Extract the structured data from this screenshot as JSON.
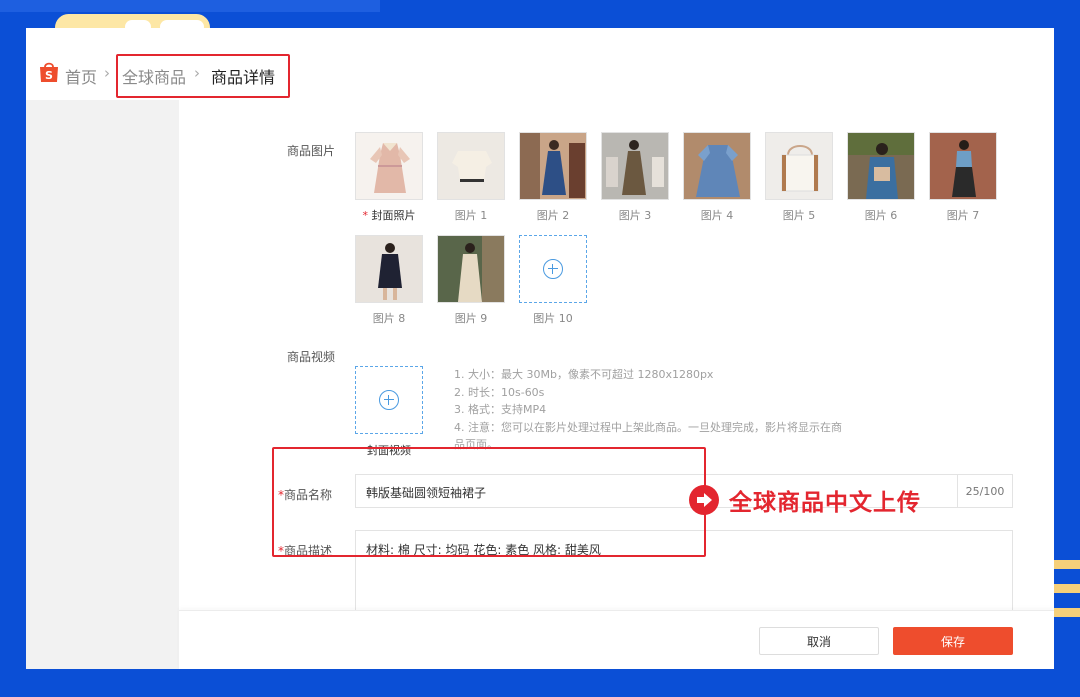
{
  "breadcrumb": {
    "home": "首页",
    "global_products": "全球商品",
    "current": "商品详情"
  },
  "form": {
    "images_label": "商品图片",
    "images": [
      {
        "caption": "封面照片",
        "required_mark": "*"
      },
      {
        "caption": "图片 1"
      },
      {
        "caption": "图片 2"
      },
      {
        "caption": "图片 3"
      },
      {
        "caption": "图片 4"
      },
      {
        "caption": "图片 5"
      },
      {
        "caption": "图片 6"
      },
      {
        "caption": "图片 7"
      },
      {
        "caption": "图片 8"
      },
      {
        "caption": "图片 9"
      }
    ],
    "add_image_caption": "图片 10",
    "video_label": "商品视频",
    "video_caption": "封面视频",
    "video_notes": [
      "1. 大小：最大 30Mb，像素不可超过 1280x1280px",
      "2. 时长：10s-60s",
      "3. 格式：支持MP4",
      "4. 注意：您可以在影片处理过程中上架此商品。一旦处理完成，影片将显示在商",
      "品页面。"
    ],
    "name_required": "*",
    "name_label": "商品名称",
    "name_value": "韩版基础圆领短袖裙子",
    "name_counter": "25/100",
    "desc_required": "*",
    "desc_label": "商品描述",
    "desc_value": "材料: 棉  尺寸: 均码  花色: 素色 风格: 甜美风"
  },
  "annotation": {
    "text": "全球商品中文上传"
  },
  "footer": {
    "cancel_label": "取消",
    "save_label": "保存"
  },
  "colors": {
    "brand": "#ee4d2d",
    "annotation_red": "#e3262f",
    "frame_blue": "#0b4fd6",
    "accent_blue": "#4a9ae0"
  }
}
